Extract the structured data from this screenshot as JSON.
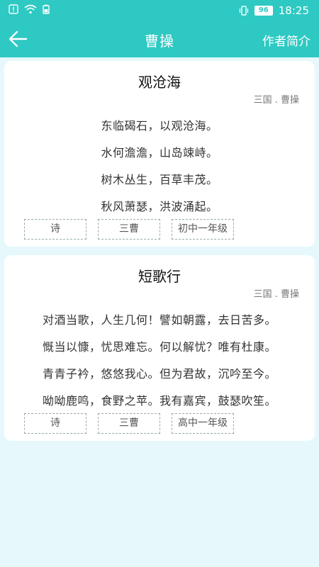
{
  "status_bar": {
    "battery": "96",
    "time": "18:25",
    "icons": [
      "alert-icon",
      "wifi-icon",
      "battery-saver-icon",
      "vibrate-icon",
      "battery-icon"
    ]
  },
  "header": {
    "title": "曹操",
    "action": "作者简介",
    "background_color": "#2ec9c3"
  },
  "poems": [
    {
      "title": "观沧海",
      "author": "三国 . 曹操",
      "lines": [
        "东临碣石，以观沧海。",
        "水何澹澹，山岛竦峙。",
        "树木丛生，百草丰茂。",
        "秋风萧瑟，洪波涌起。"
      ],
      "tags": [
        "诗",
        "三曹",
        "初中一年级"
      ]
    },
    {
      "title": "短歌行",
      "author": "三国 . 曹操",
      "lines": [
        "对酒当歌，人生几何！譬如朝露，去日苦多。",
        "慨当以慷，忧思难忘。何以解忧？唯有杜康。",
        "青青子衿，悠悠我心。但为君故，沉吟至今。",
        "呦呦鹿鸣，食野之苹。我有嘉宾，鼓瑟吹笙。"
      ],
      "tags": [
        "诗",
        "三曹",
        "高中一年级"
      ]
    }
  ]
}
